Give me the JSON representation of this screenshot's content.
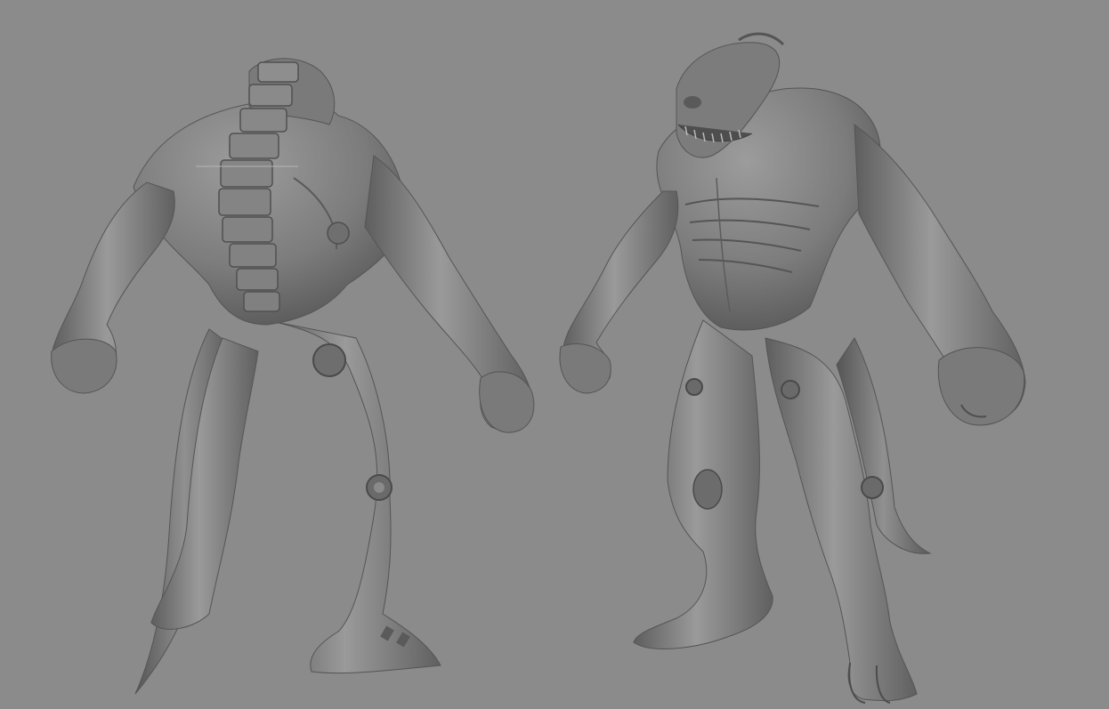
{
  "viewport": {
    "background_color": "#8b8b8b",
    "model_color": "#7a7a7a",
    "shadow_color": "#4a4a4a",
    "highlight_color": "#a2a2a2"
  },
  "models": [
    {
      "view": "back"
    },
    {
      "view": "front"
    }
  ]
}
